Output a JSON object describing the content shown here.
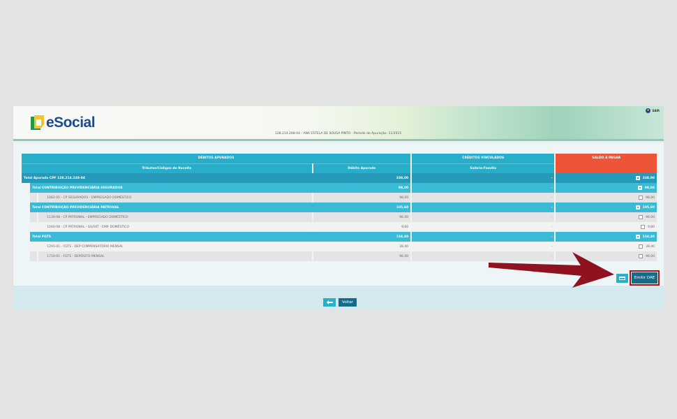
{
  "header": {
    "logo_text": "eSocial",
    "exit_label": "SAIR",
    "employer_line": "128.214.248-04 - ANA ESTELA DE SOUSA PINTO - Período de Apuração: 11/2015"
  },
  "table": {
    "group_headers": {
      "debitos": "DÉBITOS APURADOS",
      "creditos": "CRÉDITOS VINCULADOS",
      "saldo": "SALDO A PAGAR"
    },
    "sub_headers": {
      "tributos": "Tributos/Códigos de Receita",
      "debito_apurado": "Débito Apurado",
      "salario_familia": "Salário-Família"
    },
    "rows": [
      {
        "kind": "total",
        "label": "Total Apurado CPF 128.214.248-04",
        "debito": "338,00",
        "credito": "-",
        "saldo": "338,00"
      },
      {
        "kind": "group",
        "label": "Total CONTRIBUIÇÃO PREVIDENCIÁRIA SEGURADOS",
        "debito": "98,00",
        "credito": "-",
        "saldo": "98,00"
      },
      {
        "kind": "item",
        "label": "1082-05 - CP SEGURADOS - EMPREGADO DOMÉSTICO",
        "debito": "98,00",
        "credito": "-",
        "saldo": "98,00"
      },
      {
        "kind": "group",
        "label": "Total CONTRIBUIÇÃO PREVIDENCIÁRIA PATRONAL",
        "debito": "105,60",
        "credito": "-",
        "saldo": "105,60"
      },
      {
        "kind": "item",
        "label": "1130-08 - CP PATRONAL - EMPREGADO DOMÉSTICO",
        "debito": "96,00",
        "credito": "-",
        "saldo": "96,00"
      },
      {
        "kind": "item",
        "label": "1040-08 - CP PATRONAL - GILRAT - EMP. DOMÉSTICO",
        "debito": "9,60",
        "credito": "-",
        "saldo": "9,60"
      },
      {
        "kind": "group",
        "label": "Total FGTS",
        "debito": "134,40",
        "credito": "-",
        "saldo": "134,40"
      },
      {
        "kind": "item",
        "label": "1291-01 - FGTS - DEP COMPENSATÓRIO MENSAL",
        "debito": "38,40",
        "credito": "-",
        "saldo": "38,40"
      },
      {
        "kind": "item",
        "label": "1710-01 - FGTS - DEPÓSITO MENSAL",
        "debito": "96,00",
        "credito": "-",
        "saldo": "96,00"
      }
    ]
  },
  "actions": {
    "emitir_label": "Emitir DAE",
    "voltar_label": "Voltar"
  },
  "colors": {
    "header_blue": "#26aecb",
    "saldo_red": "#ee5538",
    "button_dark": "#176b88",
    "highlight_red": "#a4121a"
  }
}
